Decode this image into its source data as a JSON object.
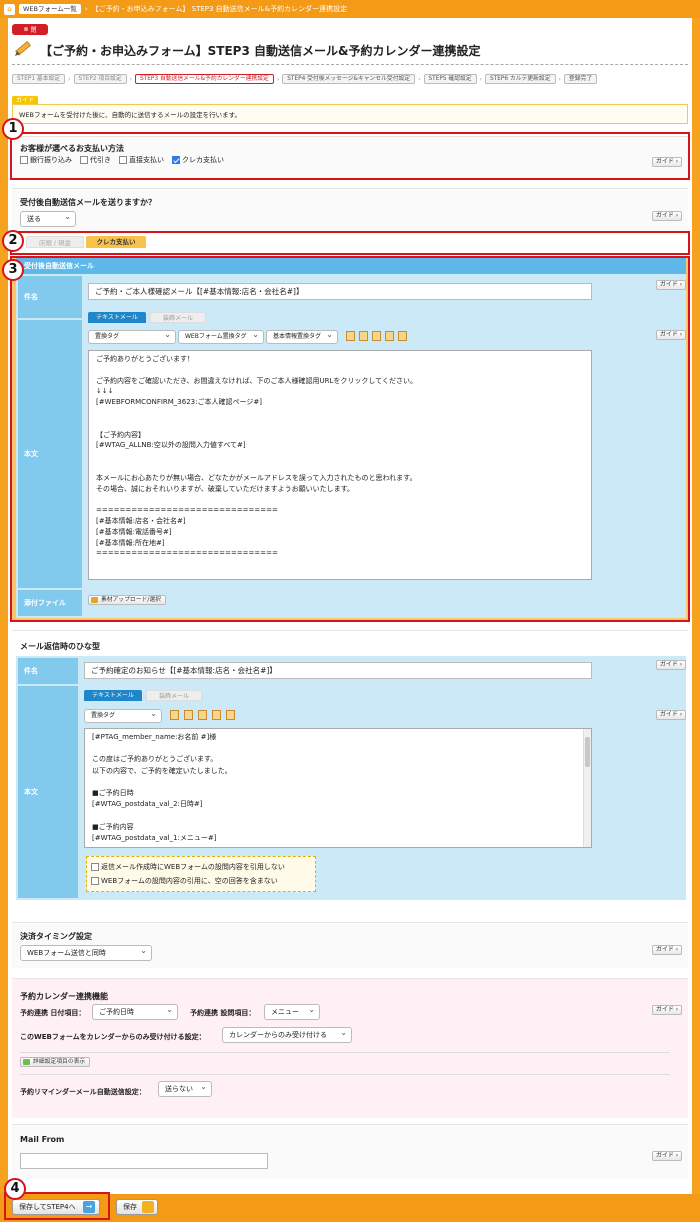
{
  "topbar": {
    "home_icon": "home-icon",
    "crumb1": "WEBフォーム一覧",
    "crumb2": "【ご予約・お申込みフォーム】 STEP3 自動送信メール&予約カレンダー連携設定"
  },
  "header": {
    "close_label": "閉",
    "title": "【ご予約・お申込みフォーム】STEP3 自動送信メール&予約カレンダー連携設定"
  },
  "steps": [
    {
      "label": "STEP1 基本設定"
    },
    {
      "label": "STEP2 項目設定"
    },
    {
      "label": "STEP3 自動送信メール&予約カレンダー連携設定"
    },
    {
      "label": "STEP4 受付後メッセージ&キャンセル受付設定"
    },
    {
      "label": "STEP5 確認設定"
    },
    {
      "label": "STEP6 カルテ更新設定"
    },
    {
      "label": "登録完了"
    }
  ],
  "guide": {
    "tag": "ガイド",
    "text": "WEBフォームを受付けた後に、自動的に送信するメールの設定を行います。"
  },
  "guide_btn": "ガイド",
  "annotations": [
    "1",
    "2",
    "3",
    "4"
  ],
  "payment": {
    "title": "お客様が選べるお支払い方法",
    "options": [
      {
        "label": "銀行振り込み",
        "checked": false
      },
      {
        "label": "代引き",
        "checked": false
      },
      {
        "label": "直接支払い",
        "checked": false
      },
      {
        "label": "クレカ支払い",
        "checked": true
      }
    ]
  },
  "auto_mail": {
    "title": "受付後自動送信メールを送りますか？",
    "select_value": "送る"
  },
  "pay_tabs": [
    "店頭 / 現金",
    "クレカ支払い"
  ],
  "mail_panel": {
    "header": "受付後自動送信メール",
    "subject_label": "件名",
    "subject_value": "ご予約・ご本人様確認メール【[#基本情報:店名・会社名#]】",
    "body_label": "本文",
    "tab_text": "テキストメール",
    "tab_html": "装飾メール",
    "tag_selects": [
      "置換タグ",
      "WEBフォーム置換タグ",
      "基本情報置換タグ"
    ],
    "body_lines": [
      "ご予約ありがとうございます！",
      "",
      "ご予約内容をご確認いただき、お間違えなければ、下のご本人様確認用URLをクリックしてください。",
      "↓↓↓",
      "[#WEBFORMCONFIRM_3623:ご本人確認ページ#]",
      "",
      "",
      "【ご予約内容】",
      "[#WTAG_ALLNB:空以外の設問入力値すべて#]",
      "",
      "",
      "本メールにお心あたりが無い場合、どなたかがメールアドレスを誤って入力されたものと思われます。",
      "その場合、誠におそれいりますが、破棄していただけますようお願いいたします。",
      "",
      "===============================",
      "[#基本情報:店名・会社名#]",
      "[#基本情報:電話番号#]",
      "[#基本情報:所在地#]",
      "==============================="
    ],
    "attach_label": "添付ファイル",
    "attach_button": "素材アップロード/選択"
  },
  "template": {
    "title": "メール返信時のひな型",
    "subject_label": "件名",
    "subject_value": "ご予約確定のお知らせ【[#基本情報:店名・会社名#]】",
    "body_label": "本文",
    "tab_text": "テキストメール",
    "tab_html": "装飾メール",
    "tag_select": "置換タグ",
    "body_lines": [
      "[#PTAG_member_name:お名前 #]様",
      "",
      "この度はご予約ありがとうございます。",
      "以下の内容で、ご予約を確定いたしました。",
      "",
      "■ご予約日時",
      "[#WTAG_postdata_val_2:日時#]",
      "",
      "■ご予約内容",
      "[#WTAG_postdata_val_1:メニュー#]"
    ],
    "opt1": "返信メール作成時にWEBフォームの設問内容を引用しない",
    "opt2": "WEBフォームの設問内容の引用に、空の回答を含まない"
  },
  "timing": {
    "title": "決済タイミング設定",
    "select_value": "WEBフォーム送信と同時"
  },
  "calendar": {
    "title": "予約カレンダー連携機能",
    "date_label": "予約連携 日付項目：",
    "date_value": "ご予約日時",
    "question_label": "予約連携 設問項目：",
    "question_value": "メニュー",
    "accept_label": "このWEBフォームをカレンダーからのみ受け付ける設定：",
    "accept_value": "カレンダーからのみ受け付ける",
    "detail_button": "詳細設定項目の表示",
    "reminder_label": "予約リマインダーメール自動送信設定：",
    "reminder_value": "送らない"
  },
  "mailfrom": {
    "title": "Mail From",
    "value": ""
  },
  "footer": {
    "save_next": "保存してSTEP4へ",
    "save": "保存"
  },
  "colors": {
    "accent": "#f39a17",
    "frame": "#d7141a",
    "blue_panel": "#cce9f8",
    "label_blue": "#82c9ee"
  }
}
